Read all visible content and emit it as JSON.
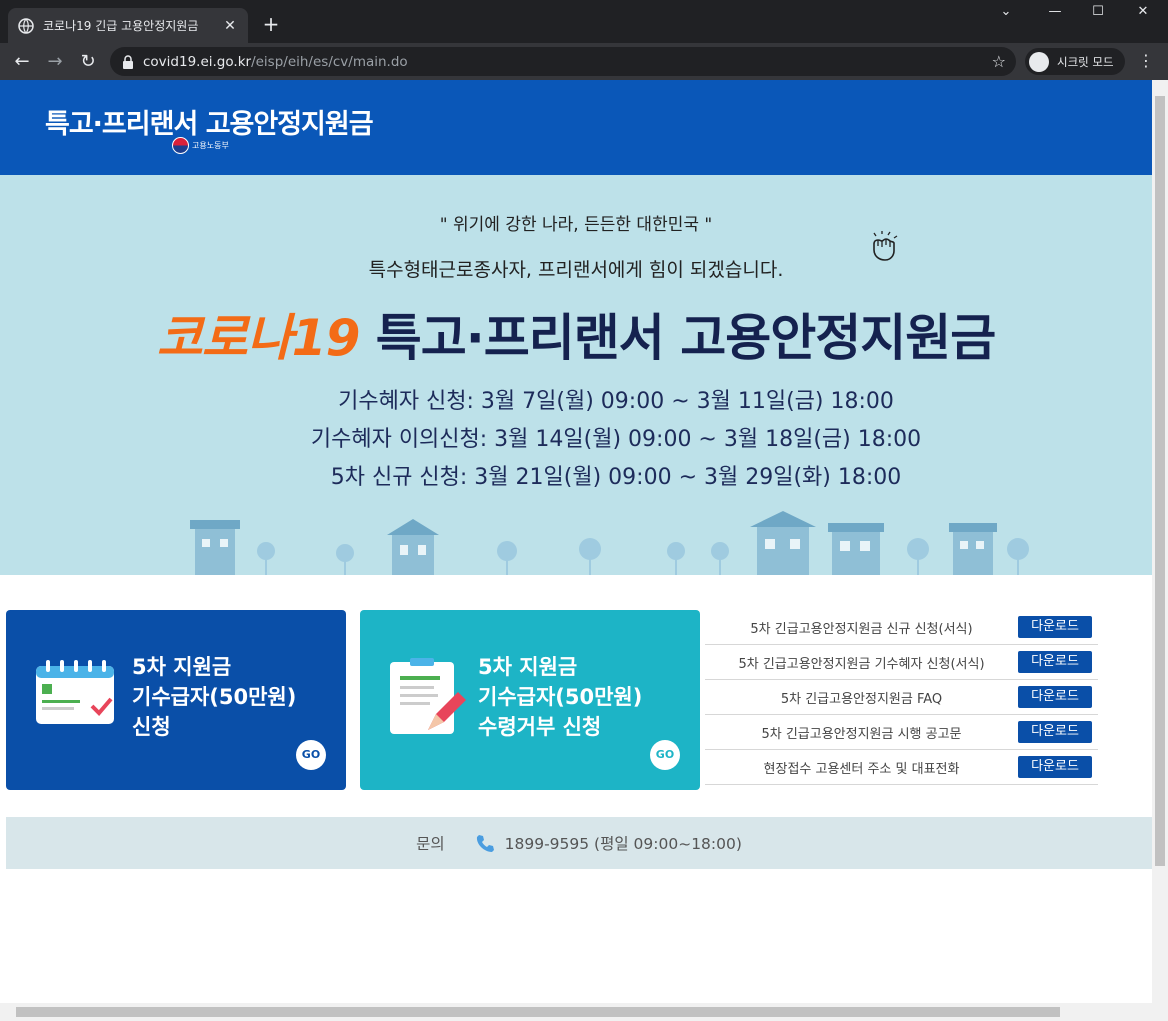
{
  "browser": {
    "tab_title": "코로나19 긴급 고용안정지원금",
    "tab_close": "✕",
    "new_tab": "+",
    "url_host": "covid19.ei.go.kr",
    "url_path": "/eisp/eih/es/cv/main.do",
    "incognito_label": "시크릿 모드",
    "back": "←",
    "forward": "→",
    "reload": "↻",
    "star": "☆",
    "menu": "⋮",
    "minimize": "—",
    "maximize": "☐",
    "close": "✕",
    "collapse": "⌄"
  },
  "header": {
    "site_title": "특고·프리랜서 고용안정지원금",
    "ministry": "고용노동부"
  },
  "hero": {
    "quote": "\" 위기에 강한 나라, 든든한 대한민국 \"",
    "subtitle": "특수형태근로종사자, 프리랜서에게 힘이 되겠습니다.",
    "title_orange": "코로나19 ",
    "title_navy": "특고·프리랜서 고용안정지원금",
    "schedule": [
      "기수혜자 신청: 3월 7일(월) 09:00 ~ 3월 11일(금) 18:00",
      "기수혜자 이의신청: 3월 14일(월) 09:00 ~ 3월 18일(금) 18:00",
      "5차 신규 신청: 3월 21일(월) 09:00 ~ 3월 29일(화) 18:00"
    ]
  },
  "cards": [
    {
      "lines": [
        "5차 지원금",
        "기수급자(50만원)",
        "신청"
      ],
      "go": "GO"
    },
    {
      "lines": [
        "5차 지원금",
        "기수급자(50만원)",
        "수령거부 신청"
      ],
      "go": "GO"
    }
  ],
  "downloads": [
    {
      "label": "5차 긴급고용안정지원금 신규 신청(서식)",
      "button": "다운로드"
    },
    {
      "label": "5차 긴급고용안정지원금 기수혜자 신청(서식)",
      "button": "다운로드"
    },
    {
      "label": "5차 긴급고용안정지원금 FAQ",
      "button": "다운로드"
    },
    {
      "label": "5차 긴급고용안정지원금 시행 공고문",
      "button": "다운로드"
    },
    {
      "label": "현장접수 고용센터 주소 및 대표전화",
      "button": "다운로드"
    }
  ],
  "contact": {
    "label": "문의",
    "phone": "1899-9595 (평일 09:00~18:00)"
  },
  "colors": {
    "header_blue": "#0a57b8",
    "hero_bg": "#bde1e9",
    "title_orange": "#f36b16",
    "card_blue": "#0a4fa8",
    "card_teal": "#1db4c6"
  }
}
